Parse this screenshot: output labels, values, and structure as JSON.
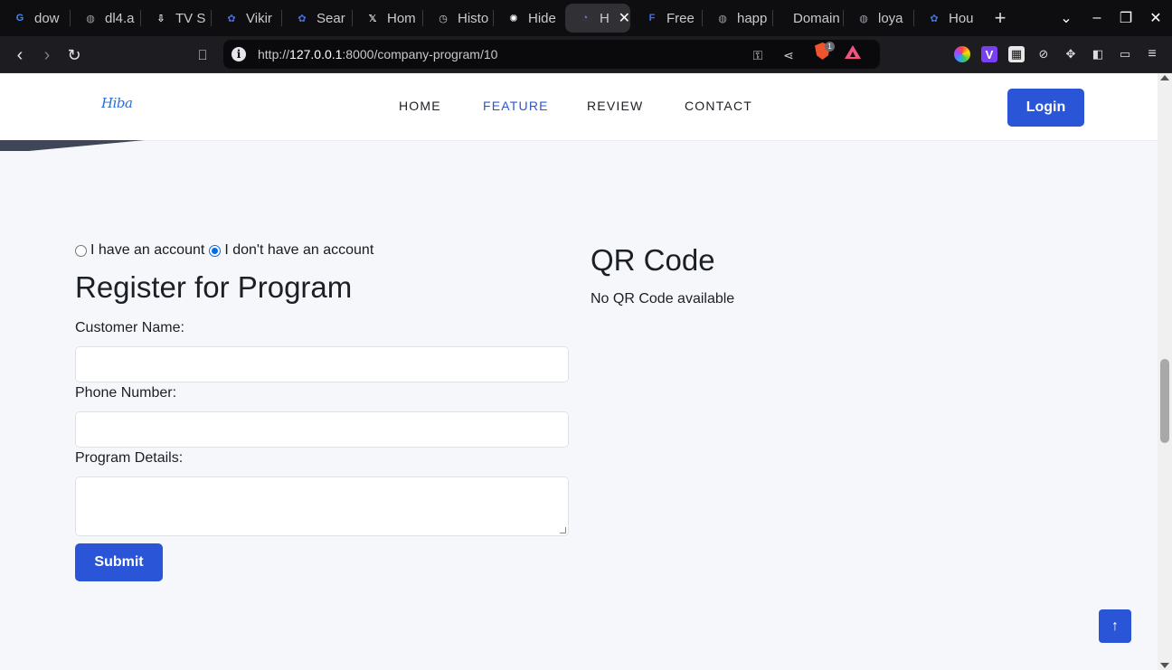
{
  "browser": {
    "tabs": [
      {
        "title": "dow",
        "icon": "google-icon",
        "color": "#4285f4",
        "glyph": "G"
      },
      {
        "title": "dl4.a",
        "icon": "globe-icon",
        "color": "#9aa0a6",
        "glyph": "◍"
      },
      {
        "title": "TV S",
        "icon": "download-icon",
        "color": "#ffffff",
        "glyph": "⇩"
      },
      {
        "title": "Vikir",
        "icon": "reel-icon",
        "color": "#4a6fd6",
        "glyph": "✿"
      },
      {
        "title": "Sear",
        "icon": "reel-icon",
        "color": "#4a6fd6",
        "glyph": "✿"
      },
      {
        "title": "Hom",
        "icon": "x-icon",
        "color": "#ffffff",
        "glyph": "𝕏"
      },
      {
        "title": "Histo",
        "icon": "history-icon",
        "color": "#cfcfd4",
        "glyph": "◷"
      },
      {
        "title": "Hide",
        "icon": "openai-icon",
        "color": "#ffffff",
        "glyph": "✺"
      },
      {
        "title": "H",
        "icon": "app-icon",
        "color": "#6a7cf0",
        "glyph": "◔",
        "active": true
      },
      {
        "title": "Free",
        "icon": "forms-icon",
        "color": "#3b6ef5",
        "glyph": "F"
      },
      {
        "title": "happ",
        "icon": "globe-icon",
        "color": "#9aa0a6",
        "glyph": "◍"
      },
      {
        "title": "Domain",
        "icon": "",
        "color": "",
        "glyph": "",
        "plain": true
      },
      {
        "title": "loya",
        "icon": "globe-icon",
        "color": "#9aa0a6",
        "glyph": "◍"
      },
      {
        "title": "Hou",
        "icon": "reel-icon",
        "color": "#4a6fd6",
        "glyph": "✿"
      }
    ],
    "url_prefix": "http://",
    "url_host": "127.0.0.1",
    "url_rest": ":8000/company-program/10",
    "brave_count": "1"
  },
  "site": {
    "logo": "Hiba",
    "nav": [
      {
        "label": "HOME",
        "active": false
      },
      {
        "label": "FEATURE",
        "active": true
      },
      {
        "label": "REVIEW",
        "active": false
      },
      {
        "label": "CONTACT",
        "active": false
      }
    ],
    "login_label": "Login"
  },
  "form": {
    "radio_have": "I have an account",
    "radio_dont": "I don't have an account",
    "selected": "dont",
    "title": "Register for Program",
    "customer_name_label": "Customer Name:",
    "customer_name_value": "",
    "phone_label": "Phone Number:",
    "phone_value": "",
    "details_label": "Program Details:",
    "details_value": "",
    "submit_label": "Submit"
  },
  "qr": {
    "title": "QR Code",
    "message": "No QR Code available"
  },
  "colors": {
    "accent": "#2a55d6",
    "page_bg": "#f6f7fa"
  }
}
